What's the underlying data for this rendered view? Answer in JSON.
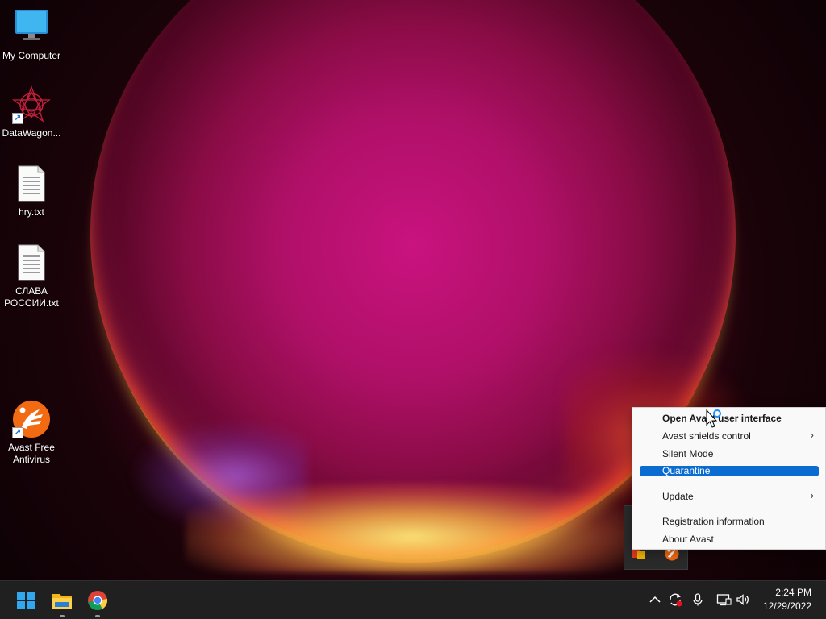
{
  "desktop": {
    "icons": [
      {
        "label": "My Computer",
        "icon": "monitor-icon"
      },
      {
        "label": "DataWagon...",
        "icon": "datawagon-icon"
      },
      {
        "label": "hry.txt",
        "icon": "text-file-icon"
      },
      {
        "label": "СЛАВА РОССИИ.txt",
        "icon": "text-file-icon"
      },
      {
        "label": "Avast Free Antivirus",
        "icon": "avast-icon"
      }
    ]
  },
  "context_menu": {
    "items": [
      {
        "label": "Open Avast user interface",
        "bold": true
      },
      {
        "label": "Avast shields control",
        "submenu": true
      },
      {
        "label": "Silent Mode"
      },
      {
        "label": "Quarantine",
        "highlighted": true
      },
      {
        "label": "Update",
        "submenu": true
      },
      {
        "label": "Registration information"
      },
      {
        "label": "About Avast"
      }
    ],
    "chevron": "›"
  },
  "taskbar": {
    "apps": [
      "start-icon",
      "file-explorer-icon",
      "chrome-icon"
    ],
    "tray": [
      "chevron-up-icon",
      "sync-icon",
      "microphone-icon",
      "network-icon",
      "volume-icon"
    ],
    "clock_time": "2:24 PM",
    "clock_date": "12/29/2022"
  },
  "colors": {
    "accent": "#0a6bd1",
    "taskbar": "#202020",
    "avast_orange": "#f26a12"
  }
}
